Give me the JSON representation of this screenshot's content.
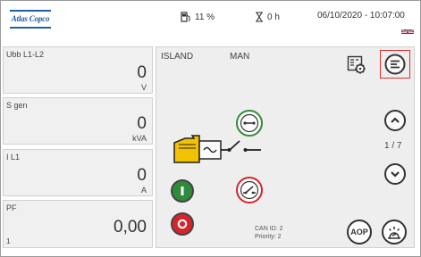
{
  "header": {
    "brand": "Atlas Copco",
    "fuel_icon": "fuel-pump-icon",
    "fuel_level": "11 %",
    "hours_icon": "hourglass-icon",
    "running_hours": "0 h",
    "datetime": "06/10/2020 - 10:07:00",
    "language_icon": "uk-flag-icon"
  },
  "measurements": [
    {
      "label": "Ubb L1-L2",
      "value": "0",
      "unit": "V"
    },
    {
      "label": "S gen",
      "value": "0",
      "unit": "kVA"
    },
    {
      "label": "I L1",
      "value": "0",
      "unit": "A"
    },
    {
      "label": "PF",
      "value": "0,00",
      "unit": "",
      "sub": "1"
    }
  ],
  "main": {
    "mode_left": "ISLAND",
    "mode_right": "MAN",
    "page_indicator": "1 / 7",
    "can_id": "CAN ID: 2",
    "priority": "Priority: 2",
    "aop_label": "AOP",
    "icons": {
      "settings": "settings-gear-icon",
      "menu": "menu-list-icon",
      "scroll_up": "chevron-up-icon",
      "scroll_down": "chevron-down-icon",
      "breaker_close": "breaker-close-icon",
      "breaker_open": "breaker-open-icon",
      "start": "start-icon",
      "stop": "stop-icon",
      "alarm": "alarm-icon"
    }
  },
  "colors": {
    "brand_blue": "#1f5fa8",
    "start_green": "#2e8b3a",
    "stop_red": "#d8232a",
    "generator_yellow": "#f2c200",
    "highlight_red": "#e03030"
  }
}
